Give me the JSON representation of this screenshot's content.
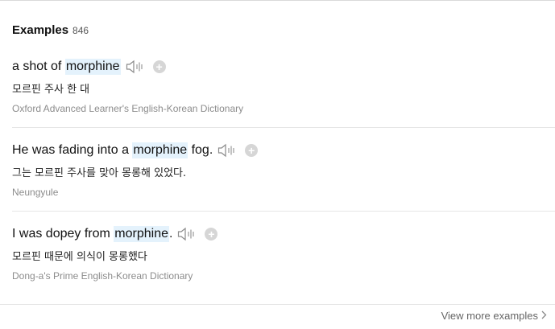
{
  "header": {
    "title": "Examples",
    "count": "846"
  },
  "examples": [
    {
      "pre": "a shot of ",
      "keyword": "morphine",
      "post": "",
      "translation": "모르핀 주사 한 대",
      "source": "Oxford Advanced Learner's English-Korean Dictionary"
    },
    {
      "pre": "He was fading into a ",
      "keyword": "morphine",
      "post": " fog.",
      "translation": "그는 모르핀 주사를 맞아 몽롱해 있었다.",
      "source": "Neungyule"
    },
    {
      "pre": "I was dopey from ",
      "keyword": "morphine",
      "post": ".",
      "translation": "모르핀 때문에 의식이 몽롱했다",
      "source": "Dong-a's Prime English-Korean Dictionary"
    }
  ],
  "icons": {
    "speaker": "speaker-icon",
    "add": "plus-circle-icon",
    "chevron": "chevron-right-icon"
  },
  "add_symbol": "+",
  "footer": {
    "more_label": "View more examples"
  },
  "colors": {
    "highlight": "#e4f2fc",
    "source_text": "#8c8c8c",
    "add_button": "#d6d6d6"
  }
}
